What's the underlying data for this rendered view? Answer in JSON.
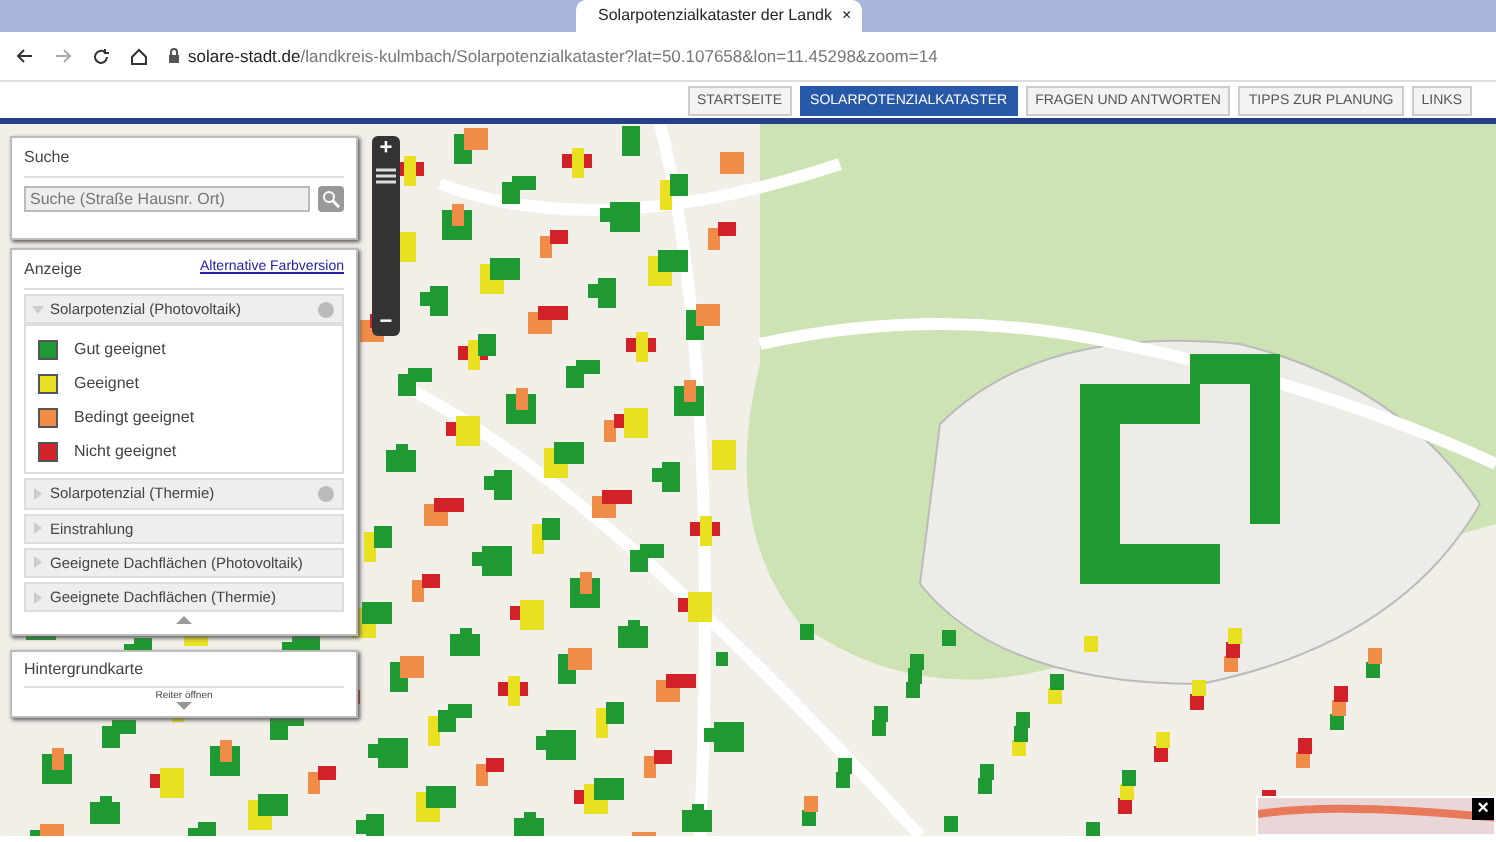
{
  "browser": {
    "tab_title": "Solarpotenzialkataster der Landk",
    "tab_close": "×",
    "url_domain": "solare-stadt.de",
    "url_path": "/landkreis-kulmbach/Solarpotenzialkataster?lat=50.107658&lon=11.45298&zoom=14"
  },
  "nav": [
    {
      "label": "STARTSEITE",
      "selected": false
    },
    {
      "label": "SOLARPOTENZIALKATASTER",
      "selected": true
    },
    {
      "label": "FRAGEN UND ANTWORTEN",
      "selected": false
    },
    {
      "label": "TIPPS ZUR PLANUNG",
      "selected": false
    },
    {
      "label": "LINKS",
      "selected": false
    }
  ],
  "search_panel": {
    "title": "Suche",
    "placeholder": "Suche (Straße Hausnr. Ort)"
  },
  "display_panel": {
    "title": "Anzeige",
    "link": "Alternative Farbversion",
    "layers": [
      {
        "label": "Solarpotenzial (Photovoltaik)",
        "expanded": true,
        "info": true,
        "legend": [
          {
            "label": "Gut geeignet",
            "color": "#1f9a32"
          },
          {
            "label": "Geeignet",
            "color": "#e8e020"
          },
          {
            "label": "Bedingt geeignet",
            "color": "#ee8c48"
          },
          {
            "label": "Nicht geeignet",
            "color": "#d02228"
          }
        ]
      },
      {
        "label": "Solarpotenzial (Thermie)",
        "expanded": false,
        "info": true
      },
      {
        "label": "Einstrahlung",
        "expanded": false,
        "info": false
      },
      {
        "label": "Geeignete Dachflächen (Photovoltaik)",
        "expanded": false,
        "info": false
      },
      {
        "label": "Geeignete Dachflächen (Thermie)",
        "expanded": false,
        "info": false
      }
    ]
  },
  "background_panel": {
    "title": "Hintergrundkarte",
    "toggle": "Reiter öffnen"
  },
  "zoom_controls": {
    "zoom_in": "+",
    "zoom_out": "−"
  },
  "minimap": {
    "close": "×"
  }
}
